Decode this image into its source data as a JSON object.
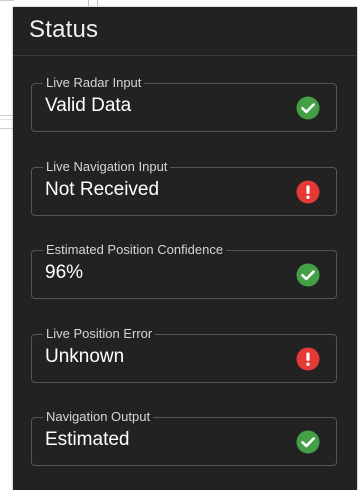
{
  "panel": {
    "title": "Status"
  },
  "fields": [
    {
      "label": "Live Radar Input",
      "value": "Valid Data",
      "status_icon": "check-circle-icon",
      "status": "ok"
    },
    {
      "label": "Live Navigation Input",
      "value": "Not Received",
      "status_icon": "alert-circle-icon",
      "status": "error"
    },
    {
      "label": "Estimated Position Confidence",
      "value": "96%",
      "status_icon": "check-circle-icon",
      "status": "ok"
    },
    {
      "label": "Live Position Error",
      "value": "Unknown",
      "status_icon": "alert-circle-icon",
      "status": "error"
    },
    {
      "label": "Navigation Output",
      "value": "Estimated",
      "status_icon": "check-circle-icon",
      "status": "ok"
    }
  ],
  "colors": {
    "panel_bg": "#222222",
    "ok": "#43a047",
    "error": "#e53935"
  }
}
